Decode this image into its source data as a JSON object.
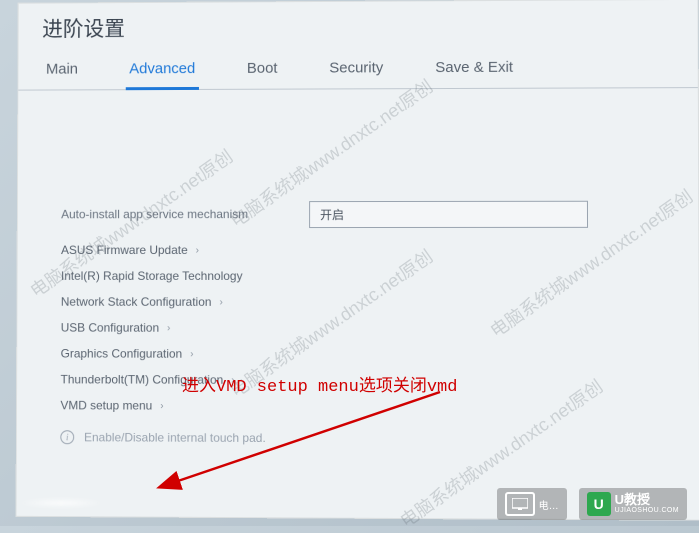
{
  "header": {
    "title": "进阶设置"
  },
  "tabs": [
    {
      "label": "Main",
      "active": false
    },
    {
      "label": "Advanced",
      "active": true
    },
    {
      "label": "Boot",
      "active": false
    },
    {
      "label": "Security",
      "active": false
    },
    {
      "label": "Save & Exit",
      "active": false
    }
  ],
  "settings": {
    "auto_app": {
      "label": "Auto-install app service mechanism",
      "value": "开启"
    }
  },
  "submenus": [
    {
      "id": "asus-firmware",
      "label": "ASUS Firmware Update"
    },
    {
      "id": "irst",
      "label": "Intel(R) Rapid Storage Technology"
    },
    {
      "id": "network-stack",
      "label": "Network Stack Configuration"
    },
    {
      "id": "usb-config",
      "label": "USB Configuration"
    },
    {
      "id": "graphics-config",
      "label": "Graphics Configuration"
    },
    {
      "id": "thunderbolt",
      "label": "Thunderbolt(TM) Configuration"
    },
    {
      "id": "vmd-setup",
      "label": "VMD setup menu"
    }
  ],
  "hint": "Enable/Disable internal touch pad.",
  "watermark_text": "电脑系统城www.dnxtc.net原创",
  "annotation": "进入VMD setup menu选项关闭vmd",
  "logos": {
    "left_text": "电…",
    "right_main": "U教授",
    "right_sub": "UJIAOSHOU.COM"
  }
}
